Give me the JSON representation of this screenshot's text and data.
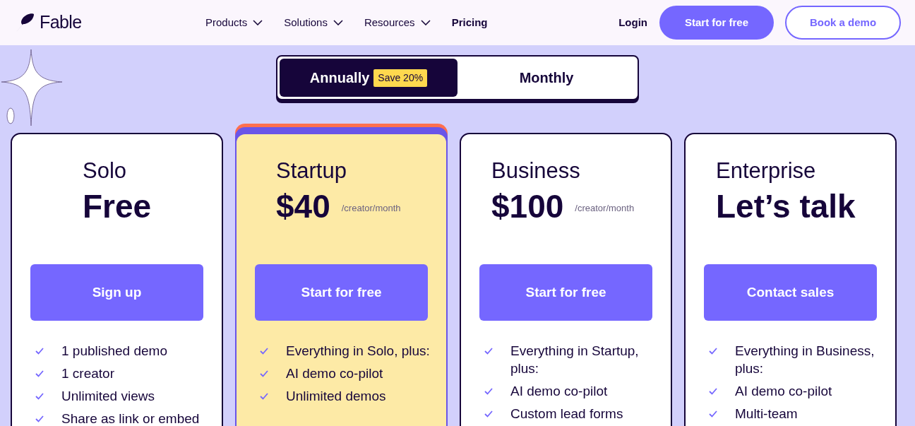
{
  "header": {
    "logo": "Fable",
    "nav": [
      {
        "label": "Products",
        "kind": "dropdown"
      },
      {
        "label": "Solutions",
        "kind": "dropdown"
      },
      {
        "label": "Resources",
        "kind": "dropdown"
      },
      {
        "label": "Pricing",
        "kind": "link"
      }
    ],
    "login": "Login",
    "primary_cta": "Start for free",
    "secondary_cta": "Book a demo"
  },
  "billing_toggle": [
    {
      "label": "Annually",
      "badge": "Save 20%",
      "selected": true
    },
    {
      "label": "Monthly",
      "selected": false
    }
  ],
  "plans": [
    {
      "name": "Solo",
      "price": "Free",
      "featured": false,
      "button": "Sign up",
      "features": [
        "1 published demo",
        "1 creator",
        "Unlimited views",
        "Share as link or embed"
      ]
    },
    {
      "name": "Startup",
      "price": "$40",
      "period": "/creator/month",
      "featured": true,
      "button": "Start for free",
      "features": [
        "Everything in Solo, plus:",
        "AI demo co-pilot",
        "Unlimited demos"
      ]
    },
    {
      "name": "Business",
      "price": "$100",
      "period": "/creator/month",
      "featured": false,
      "button": "Start for free",
      "features": [
        "Everything in Startup, plus:",
        "AI demo co-pilot",
        "Custom lead forms"
      ]
    },
    {
      "name": "Enterprise",
      "price": "Let’s talk",
      "featured": false,
      "button": "Contact sales",
      "features": [
        "Everything in Business, plus:",
        "AI demo co-pilot",
        "Multi-team"
      ]
    }
  ]
}
